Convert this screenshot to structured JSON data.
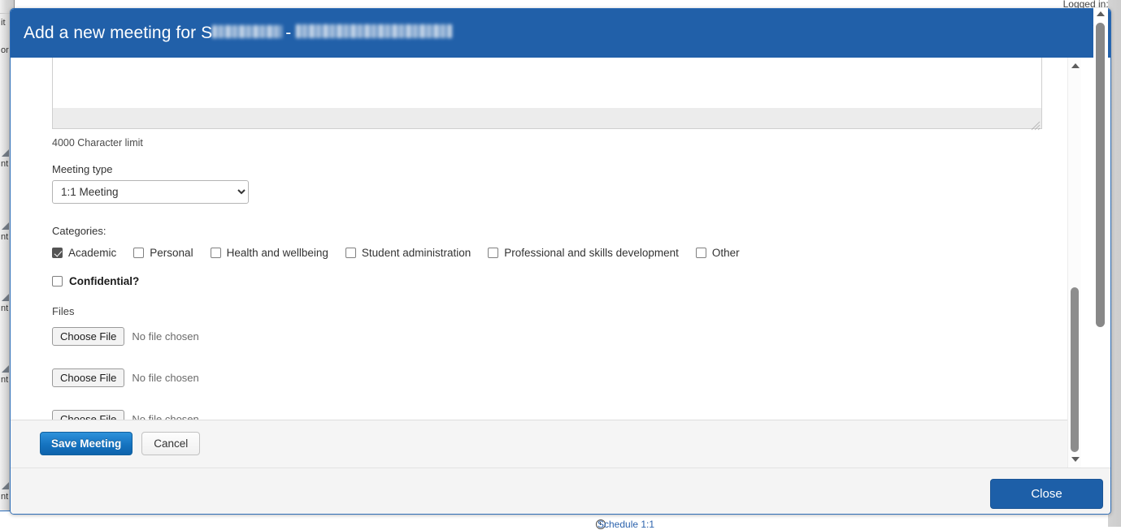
{
  "background": {
    "logged_in_text": "Logged in: (",
    "schedule_link": "Schedule 1:1",
    "row_fragments": [
      "it",
      "or",
      "nt",
      "nt",
      "nt",
      "nt",
      "nt"
    ]
  },
  "modal": {
    "title_prefix": "Add a new meeting for S",
    "title_separator": "-",
    "title_redacted_1": "",
    "title_redacted_2": "",
    "header_color": "#2160a9",
    "resize_grip_icon": "resize-grip-icon",
    "footer": {
      "close_label": "Close",
      "close_color": "#1d5fa8"
    }
  },
  "form": {
    "notes": {
      "value": "",
      "placeholder": "",
      "char_limit_text": "4000 Character limit",
      "resize_grip_icon": "textarea-resize-grip-icon"
    },
    "meeting_type": {
      "label": "Meeting type",
      "selected": "1:1 Meeting",
      "options": [
        "1:1 Meeting"
      ]
    },
    "categories": {
      "label": "Categories:",
      "items": [
        {
          "label": "Academic",
          "checked": true
        },
        {
          "label": "Personal",
          "checked": false
        },
        {
          "label": "Health and wellbeing",
          "checked": false
        },
        {
          "label": "Student administration",
          "checked": false
        },
        {
          "label": "Professional and skills development",
          "checked": false
        },
        {
          "label": "Other",
          "checked": false
        }
      ]
    },
    "confidential": {
      "label": "Confidential?",
      "checked": false
    },
    "files": {
      "label": "Files",
      "rows": [
        {
          "button_label": "Choose File",
          "status": "No file chosen"
        },
        {
          "button_label": "Choose File",
          "status": "No file chosen"
        },
        {
          "button_label": "Choose File",
          "status": "No file chosen"
        }
      ]
    },
    "actions": {
      "save_label": "Save Meeting",
      "cancel_label": "Cancel",
      "save_color": "#1573c0"
    }
  }
}
